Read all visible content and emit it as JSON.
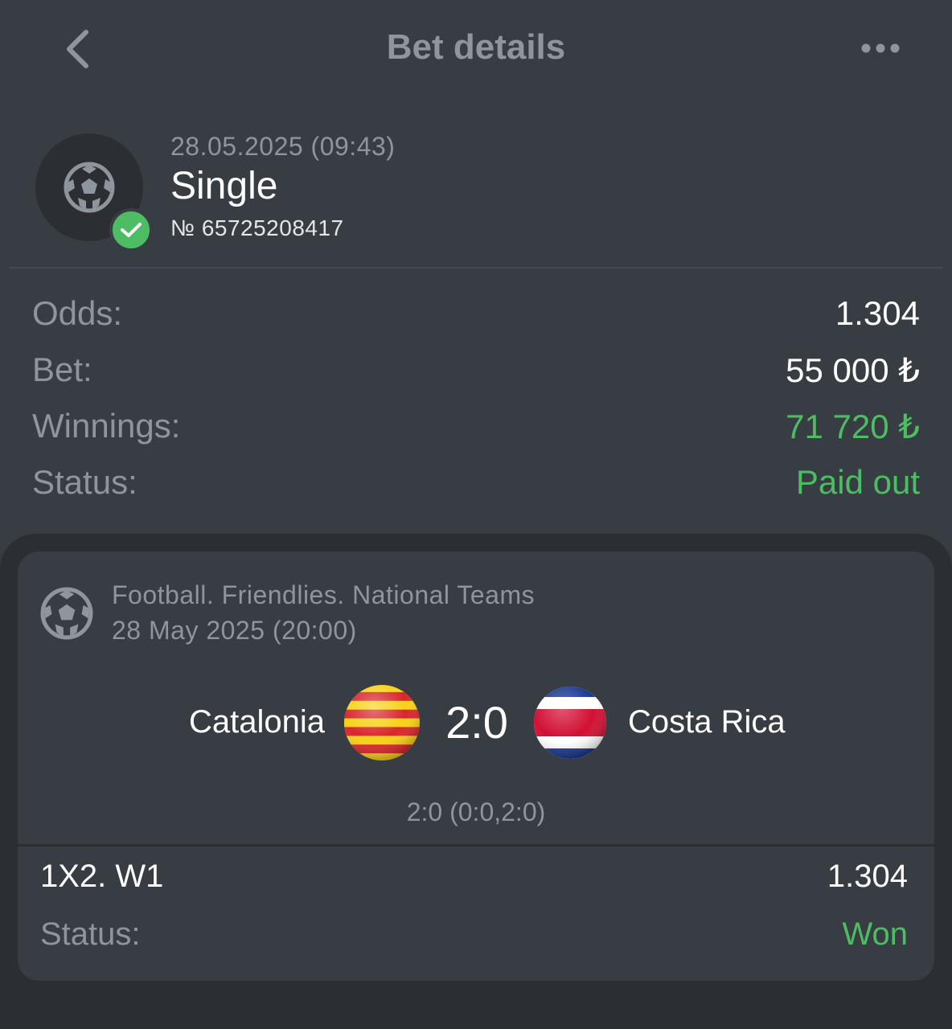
{
  "header": {
    "title": "Bet details",
    "back_icon": "chevron-left-icon",
    "more_icon": "more-dots-icon"
  },
  "bet": {
    "date": "28.05.2025 (09:43)",
    "type": "Single",
    "number": "№ 65725208417",
    "icon": "football-icon",
    "badge_icon": "check-icon"
  },
  "summary": {
    "odds_label": "Odds:",
    "odds_value": "1.304",
    "bet_label": "Bet:",
    "bet_value": "55 000 ₺",
    "winnings_label": "Winnings:",
    "winnings_value": "71 720 ₺",
    "status_label": "Status:",
    "status_value": "Paid out"
  },
  "event": {
    "league": "Football. Friendlies. National Teams",
    "date": "28 May 2025 (20:00)",
    "home_team": "Catalonia",
    "away_team": "Costa Rica",
    "score": "2:0",
    "score_detail": "2:0 (0:0,2:0)",
    "market": "1X2. W1",
    "market_odds": "1.304",
    "status_label": "Status:",
    "status_value": "Won"
  },
  "colors": {
    "background": "#383d43",
    "card_outer": "#2b2f33",
    "muted_text": "#8f959c",
    "success_green": "#4dbd63"
  }
}
